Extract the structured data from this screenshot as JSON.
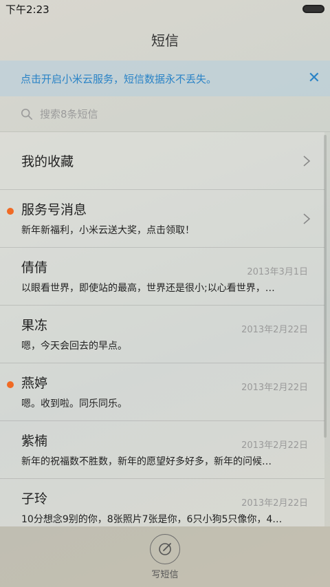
{
  "status_bar": {
    "time": "下午2:23"
  },
  "header": {
    "title": "短信"
  },
  "notice": {
    "text": "点击开启小米云服务，短信数据永不丢失。"
  },
  "search": {
    "placeholder": "搜索8条短信"
  },
  "favorites": {
    "label": "我的收藏"
  },
  "conversations": [
    {
      "name": "服务号消息",
      "preview": "新年新福利，小米云送大奖，点击领取！",
      "date": "",
      "unread": true
    },
    {
      "name": "倩倩",
      "preview": "以眼看世界，即使站的最高，世界还是很小;以心看世界，…",
      "date": "2013年3月1日",
      "unread": false
    },
    {
      "name": "果冻",
      "preview": "嗯，今天会回去的早点。",
      "date": "2013年2月22日",
      "unread": false
    },
    {
      "name": "燕婷",
      "preview": "嗯。收到啦。同乐同乐。",
      "date": "2013年2月22日",
      "unread": true
    },
    {
      "name": "紫楠",
      "preview": "新年的祝福数不胜数，新年的愿望好多好多，新年的问候…",
      "date": "2013年2月22日",
      "unread": false
    },
    {
      "name": "子玲",
      "preview": "10分想念9别的你，8张照片7张是你，6只小狗5只像你，4…",
      "date": "2013年2月22日",
      "unread": false
    }
  ],
  "bottom": {
    "compose_label": "写短信"
  },
  "colors": {
    "accent": "#2a83c6",
    "unread_dot": "#f06a24"
  }
}
